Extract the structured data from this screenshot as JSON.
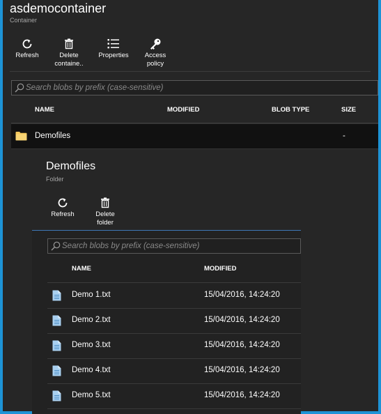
{
  "container": {
    "title": "asdemocontainer",
    "subtitle": "Container",
    "toolbar": [
      {
        "label": "Refresh",
        "icon": "refresh-icon"
      },
      {
        "label": "Delete\ncontaine..",
        "icon": "trash-icon"
      },
      {
        "label": "Properties",
        "icon": "list-icon"
      },
      {
        "label": "Access\npolicy",
        "icon": "key-icon"
      }
    ],
    "search_placeholder": "Search blobs by prefix (case-sensitive)",
    "columns": [
      "NAME",
      "MODIFIED",
      "BLOB TYPE",
      "SIZE"
    ],
    "rows": [
      {
        "name": "Demofiles",
        "modified": "",
        "blob_type": "",
        "size": "-",
        "icon": "folder-icon"
      }
    ]
  },
  "folder": {
    "title": "Demofiles",
    "subtitle": "Folder",
    "toolbar": [
      {
        "label": "Refresh",
        "icon": "refresh-icon"
      },
      {
        "label": "Delete\nfolder",
        "icon": "trash-icon"
      }
    ],
    "search_placeholder": "Search blobs by prefix (case-sensitive)",
    "columns": [
      "NAME",
      "MODIFIED"
    ],
    "rows": [
      {
        "name": "Demo 1.txt",
        "modified": "15/04/2016, 14:24:20",
        "icon": "file-icon"
      },
      {
        "name": "Demo 2.txt",
        "modified": "15/04/2016, 14:24:20",
        "icon": "file-icon"
      },
      {
        "name": "Demo 3.txt",
        "modified": "15/04/2016, 14:24:20",
        "icon": "file-icon"
      },
      {
        "name": "Demo 4.txt",
        "modified": "15/04/2016, 14:24:20",
        "icon": "file-icon"
      },
      {
        "name": "Demo 5.txt",
        "modified": "15/04/2016, 14:24:20",
        "icon": "file-icon"
      }
    ]
  },
  "colors": {
    "background": "#262626",
    "border": "#1d93d6",
    "accent_line": "#3f78b8",
    "folder": "#f4c75b",
    "file": "#a9d0f0"
  }
}
